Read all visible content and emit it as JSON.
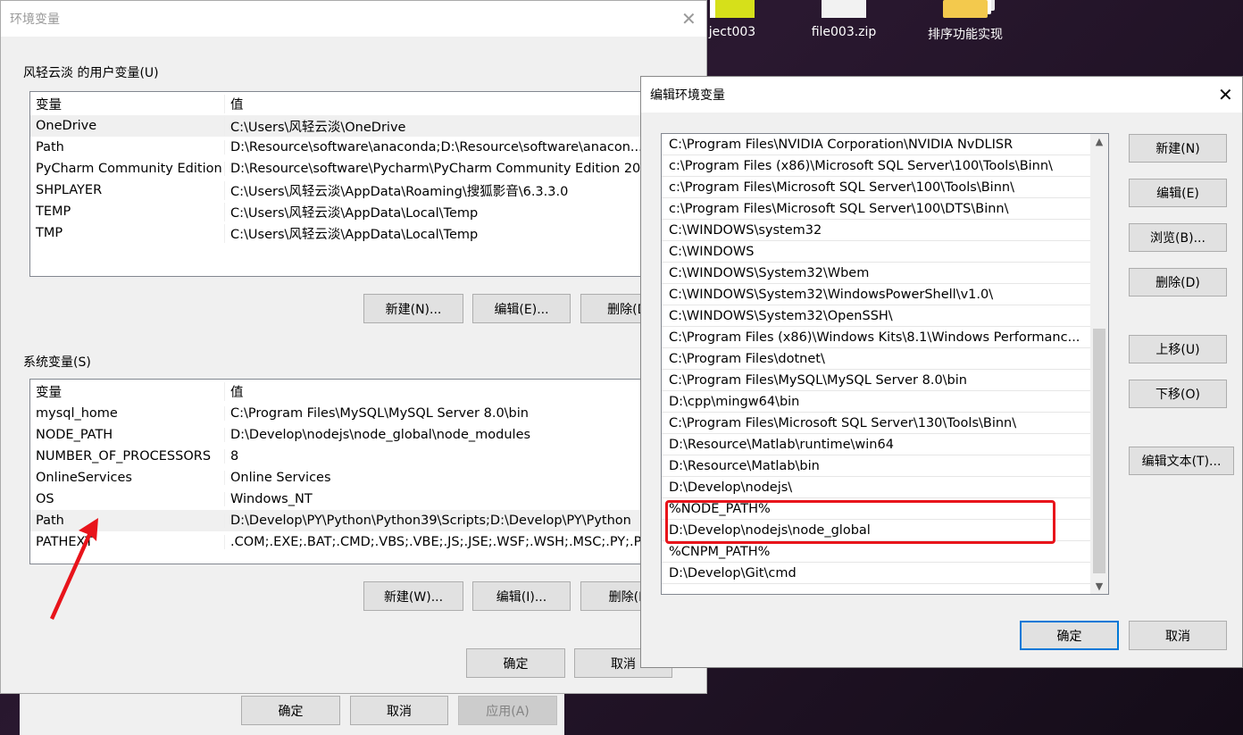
{
  "desktop": {
    "icons": [
      {
        "label": "ject003"
      },
      {
        "label": "file003.zip"
      },
      {
        "label": "排序功能实现"
      }
    ]
  },
  "properties_dialog": {
    "buttons": {
      "ok": "确定",
      "cancel": "取消",
      "apply": "应用(A)"
    }
  },
  "env_dialog": {
    "title": "环境变量",
    "user_group_label": "风轻云淡 的用户变量(U)",
    "columns": {
      "name": "变量",
      "value": "值"
    },
    "user_vars": [
      {
        "name": "OneDrive",
        "value": "C:\\Users\\风轻云淡\\OneDrive"
      },
      {
        "name": "Path",
        "value": "D:\\Resource\\software\\anaconda;D:\\Resource\\software\\anacon..."
      },
      {
        "name": "PyCharm Community Edition",
        "value": "D:\\Resource\\software\\Pycharm\\PyCharm Community Edition 20"
      },
      {
        "name": "SHPLAYER",
        "value": "C:\\Users\\风轻云淡\\AppData\\Roaming\\搜狐影音\\6.3.3.0"
      },
      {
        "name": "TEMP",
        "value": "C:\\Users\\风轻云淡\\AppData\\Local\\Temp"
      },
      {
        "name": "TMP",
        "value": "C:\\Users\\风轻云淡\\AppData\\Local\\Temp"
      }
    ],
    "user_buttons": {
      "new": "新建(N)...",
      "edit": "编辑(E)...",
      "delete": "删除(D)"
    },
    "system_group_label": "系统变量(S)",
    "system_vars": [
      {
        "name": "mysql_home",
        "value": "C:\\Program Files\\MySQL\\MySQL Server 8.0\\bin"
      },
      {
        "name": "NODE_PATH",
        "value": "D:\\Develop\\nodejs\\node_global\\node_modules"
      },
      {
        "name": "NUMBER_OF_PROCESSORS",
        "value": "8"
      },
      {
        "name": "OnlineServices",
        "value": "Online Services"
      },
      {
        "name": "OS",
        "value": "Windows_NT"
      },
      {
        "name": "Path",
        "value": "D:\\Develop\\PY\\Python\\Python39\\Scripts;D:\\Develop\\PY\\Python"
      },
      {
        "name": "PATHEXT",
        "value": ".COM;.EXE;.BAT;.CMD;.VBS;.VBE;.JS;.JSE;.WSF;.WSH;.MSC;.PY;.PY"
      }
    ],
    "system_buttons": {
      "new": "新建(W)...",
      "edit": "编辑(I)...",
      "delete": "删除(L)"
    },
    "ok": "确定",
    "cancel": "取消"
  },
  "edit_dialog": {
    "title": "编辑环境变量",
    "close": "✕",
    "paths": [
      "C:\\Program Files\\NVIDIA Corporation\\NVIDIA NvDLISR",
      "c:\\Program Files (x86)\\Microsoft SQL Server\\100\\Tools\\Binn\\",
      "c:\\Program Files\\Microsoft SQL Server\\100\\Tools\\Binn\\",
      "c:\\Program Files\\Microsoft SQL Server\\100\\DTS\\Binn\\",
      "C:\\WINDOWS\\system32",
      "C:\\WINDOWS",
      "C:\\WINDOWS\\System32\\Wbem",
      "C:\\WINDOWS\\System32\\WindowsPowerShell\\v1.0\\",
      "C:\\WINDOWS\\System32\\OpenSSH\\",
      "C:\\Program Files (x86)\\Windows Kits\\8.1\\Windows Performanc...",
      "C:\\Program Files\\dotnet\\",
      "C:\\Program Files\\MySQL\\MySQL Server 8.0\\bin",
      "D:\\cpp\\mingw64\\bin",
      "C:\\Program Files\\Microsoft SQL Server\\130\\Tools\\Binn\\",
      "D:\\Resource\\Matlab\\runtime\\win64",
      "D:\\Resource\\Matlab\\bin",
      "D:\\Develop\\nodejs\\",
      "%NODE_PATH%",
      "D:\\Develop\\nodejs\\node_global",
      "%CNPM_PATH%",
      "D:\\Develop\\Git\\cmd"
    ],
    "buttons": {
      "new": "新建(N)",
      "edit": "编辑(E)",
      "browse": "浏览(B)...",
      "delete": "删除(D)",
      "move_up": "上移(U)",
      "move_down": "下移(O)",
      "edit_text": "编辑文本(T)..."
    },
    "ok": "确定",
    "cancel": "取消"
  },
  "colors": {
    "highlight": "#e8141b",
    "accent": "#0078d7"
  }
}
